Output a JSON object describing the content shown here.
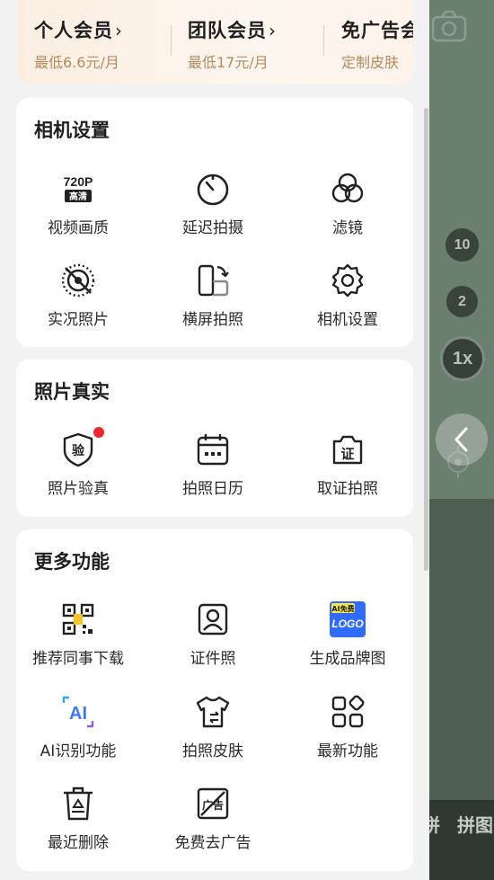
{
  "vip": {
    "items": [
      {
        "title": "个人会员",
        "chevron": "›",
        "subtitle": "最低6.6元/月"
      },
      {
        "title": "团队会员",
        "chevron": "›",
        "subtitle": "最低17元/月"
      },
      {
        "title": "免广告会",
        "chevron": "",
        "subtitle": "定制皮肤"
      }
    ]
  },
  "camera_settings": {
    "title": "相机设置",
    "items": [
      {
        "label": "视频画质",
        "icon": "video-quality-720p-icon",
        "badge_top": "720P",
        "badge_bottom": "高清"
      },
      {
        "label": "延迟拍摄",
        "icon": "timer-icon"
      },
      {
        "label": "滤镜",
        "icon": "filter-icon"
      },
      {
        "label": "实况照片",
        "icon": "live-photo-off-icon"
      },
      {
        "label": "横屏拍照",
        "icon": "rotate-landscape-icon"
      },
      {
        "label": "相机设置",
        "icon": "gear-icon"
      }
    ]
  },
  "photo_authentic": {
    "title": "照片真实",
    "items": [
      {
        "label": "照片验真",
        "icon": "verify-shield-icon",
        "glyph": "验",
        "has_dot": true
      },
      {
        "label": "拍照日历",
        "icon": "calendar-icon"
      },
      {
        "label": "取证拍照",
        "icon": "evidence-camera-icon",
        "glyph": "证"
      }
    ]
  },
  "more_features": {
    "title": "更多功能",
    "items": [
      {
        "label": "推荐同事下载",
        "icon": "qr-code-icon"
      },
      {
        "label": "证件照",
        "icon": "id-photo-icon"
      },
      {
        "label": "生成品牌图",
        "icon": "ai-logo-icon",
        "badge_top": "AI免费",
        "badge_bottom": "LOGO"
      },
      {
        "label": "AI识别功能",
        "icon": "ai-recognize-icon",
        "glyph": "AI"
      },
      {
        "label": "拍照皮肤",
        "icon": "skin-shirt-icon"
      },
      {
        "label": "最新功能",
        "icon": "apps-grid-icon"
      },
      {
        "label": "最近删除",
        "icon": "recycle-bin-icon"
      },
      {
        "label": "免费去广告",
        "icon": "no-ads-icon",
        "glyph": "广告"
      }
    ]
  },
  "camera": {
    "zoom_levels": [
      "10",
      "2",
      "1x"
    ],
    "bottom_texts": [
      "拼",
      "拼图"
    ]
  },
  "colors": {
    "accent_red": "#f0262c",
    "vip_subtitle": "#b48a60",
    "ai_blue": "#2f6bff"
  }
}
